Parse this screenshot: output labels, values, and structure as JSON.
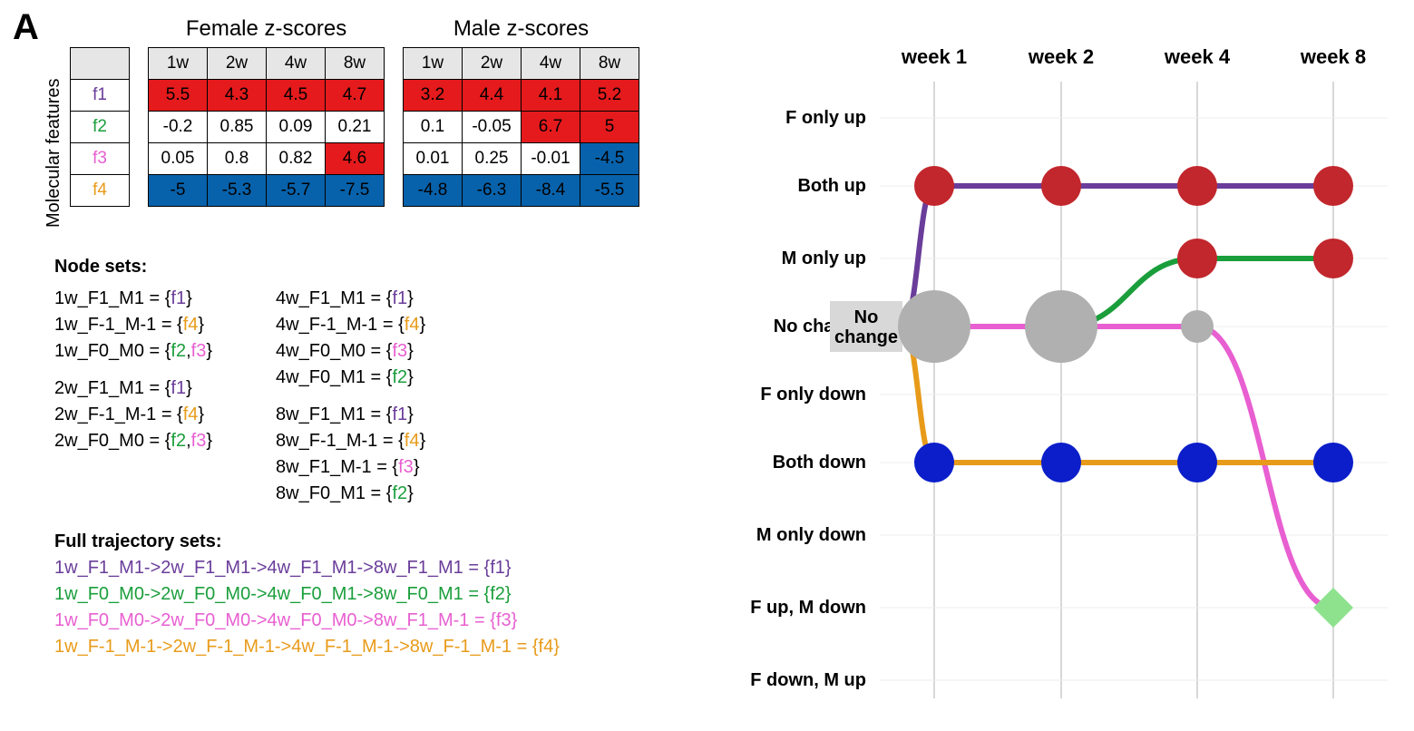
{
  "panel": "A",
  "rowLabelTitle": "Molecular features",
  "tables": {
    "female": {
      "title": "Female z-scores",
      "headers": [
        "1w",
        "2w",
        "4w",
        "8w"
      ],
      "rows": [
        {
          "feat": "f1",
          "vals": [
            "5.5",
            "4.3",
            "4.5",
            "4.7"
          ],
          "cls": [
            "cell-red",
            "cell-red",
            "cell-red",
            "cell-red"
          ]
        },
        {
          "feat": "f2",
          "vals": [
            "-0.2",
            "0.85",
            "0.09",
            "0.21"
          ],
          "cls": [
            "cell-wh",
            "cell-wh",
            "cell-wh",
            "cell-wh"
          ]
        },
        {
          "feat": "f3",
          "vals": [
            "0.05",
            "0.8",
            "0.82",
            "4.6"
          ],
          "cls": [
            "cell-wh",
            "cell-wh",
            "cell-wh",
            "cell-red"
          ]
        },
        {
          "feat": "f4",
          "vals": [
            "-5",
            "-5.3",
            "-5.7",
            "-7.5"
          ],
          "cls": [
            "cell-blue",
            "cell-blue",
            "cell-blue",
            "cell-blue"
          ]
        }
      ]
    },
    "male": {
      "title": "Male z-scores",
      "headers": [
        "1w",
        "2w",
        "4w",
        "8w"
      ],
      "rows": [
        {
          "feat": "f1",
          "vals": [
            "3.2",
            "4.4",
            "4.1",
            "5.2"
          ],
          "cls": [
            "cell-red",
            "cell-red",
            "cell-red",
            "cell-red"
          ]
        },
        {
          "feat": "f2",
          "vals": [
            "0.1",
            "-0.05",
            "6.7",
            "5"
          ],
          "cls": [
            "cell-wh",
            "cell-wh",
            "cell-red",
            "cell-red"
          ]
        },
        {
          "feat": "f3",
          "vals": [
            "0.01",
            "0.25",
            "-0.01",
            "-4.5"
          ],
          "cls": [
            "cell-wh",
            "cell-wh",
            "cell-wh",
            "cell-blue"
          ]
        },
        {
          "feat": "f4",
          "vals": [
            "-4.8",
            "-6.3",
            "-8.4",
            "-5.5"
          ],
          "cls": [
            "cell-blue",
            "cell-blue",
            "cell-blue",
            "cell-blue"
          ]
        }
      ]
    }
  },
  "nodeSetsTitle": "Node sets:",
  "nodeSetsLeft": [
    [
      "1w_F1_M1 = {",
      "f1",
      "}"
    ],
    [
      "1w_F-1_M-1 = {",
      "f4",
      "}"
    ],
    [
      "1w_F0_M0 = {",
      "f2",
      ",",
      "f3",
      "}"
    ],
    "",
    [
      "2w_F1_M1 = {",
      "f1",
      "}"
    ],
    [
      "2w_F-1_M-1 = {",
      "f4",
      "}"
    ],
    [
      "2w_F0_M0 = {",
      "f2",
      ",",
      "f3",
      "}"
    ]
  ],
  "nodeSetsRight": [
    [
      "4w_F1_M1 = {",
      "f1",
      "}"
    ],
    [
      "4w_F-1_M-1 = {",
      "f4",
      "}"
    ],
    [
      "4w_F0_M0 = {",
      "f3",
      "}"
    ],
    [
      "4w_F0_M1 = {",
      "f2",
      "}"
    ],
    "",
    [
      "8w_F1_M1 = {",
      "f1",
      "}"
    ],
    [
      "8w_F-1_M-1 = {",
      "f4",
      "}"
    ],
    [
      "8w_F1_M-1 = {",
      "f3",
      "}"
    ],
    [
      "8w_F0_M1 = {",
      "f2",
      "}"
    ]
  ],
  "fullTrajTitle": "Full trajectory sets:",
  "fullTraj": [
    {
      "cls": "c-f1",
      "text": "1w_F1_M1->2w_F1_M1->4w_F1_M1->8w_F1_M1 = {f1}"
    },
    {
      "cls": "c-f2",
      "text": "1w_F0_M0->2w_F0_M0->4w_F0_M1->8w_F0_M1 = {f2}"
    },
    {
      "cls": "c-f3",
      "text": "1w_F0_M0->2w_F0_M0->4w_F0_M0->8w_F1_M-1 = {f3}"
    },
    {
      "cls": "c-f4",
      "text": "1w_F-1_M-1->2w_F-1_M-1->4w_F-1_M-1->8w_F-1_M-1 = {f4}"
    }
  ],
  "chart_data": {
    "type": "trajectory-graph",
    "x_labels": [
      "week 1",
      "week 2",
      "week 4",
      "week 8"
    ],
    "y_categories": [
      "F only up",
      "Both up",
      "M only up",
      "No change",
      "F only down",
      "Both down",
      "M only down",
      "F up, M down",
      "F down, M up"
    ],
    "start_label": "No\nchange",
    "colors": {
      "f1": "#6a3d9a",
      "f2": "#1a9e3b",
      "f3": "#e85fd1",
      "f4": "#e89b1a",
      "node_up": "#c1272d",
      "node_down": "#0b1eca",
      "node_nc": "#b0b0b0",
      "node_opp": "#8ee28e"
    },
    "series": [
      {
        "name": "f1",
        "y": [
          "Both up",
          "Both up",
          "Both up",
          "Both up"
        ]
      },
      {
        "name": "f2",
        "y": [
          "No change",
          "No change",
          "M only up",
          "M only up"
        ]
      },
      {
        "name": "f3",
        "y": [
          "No change",
          "No change",
          "No change",
          "F up, M down"
        ]
      },
      {
        "name": "f4",
        "y": [
          "Both down",
          "Both down",
          "Both down",
          "Both down"
        ]
      }
    ],
    "nodes": [
      {
        "x": "week 1",
        "y": "Both up",
        "color": "node_up",
        "r": 22
      },
      {
        "x": "week 2",
        "y": "Both up",
        "color": "node_up",
        "r": 22
      },
      {
        "x": "week 4",
        "y": "Both up",
        "color": "node_up",
        "r": 22
      },
      {
        "x": "week 8",
        "y": "Both up",
        "color": "node_up",
        "r": 22
      },
      {
        "x": "week 4",
        "y": "M only up",
        "color": "node_up",
        "r": 22
      },
      {
        "x": "week 8",
        "y": "M only up",
        "color": "node_up",
        "r": 22
      },
      {
        "x": "week 1",
        "y": "No change",
        "color": "node_nc",
        "r": 40
      },
      {
        "x": "week 2",
        "y": "No change",
        "color": "node_nc",
        "r": 40
      },
      {
        "x": "week 4",
        "y": "No change",
        "color": "node_nc",
        "r": 18
      },
      {
        "x": "week 1",
        "y": "Both down",
        "color": "node_down",
        "r": 22
      },
      {
        "x": "week 2",
        "y": "Both down",
        "color": "node_down",
        "r": 22
      },
      {
        "x": "week 4",
        "y": "Both down",
        "color": "node_down",
        "r": 22
      },
      {
        "x": "week 8",
        "y": "Both down",
        "color": "node_down",
        "r": 22
      },
      {
        "x": "week 8",
        "y": "F up, M down",
        "color": "node_opp",
        "r": 22,
        "shape": "diamond"
      }
    ]
  }
}
